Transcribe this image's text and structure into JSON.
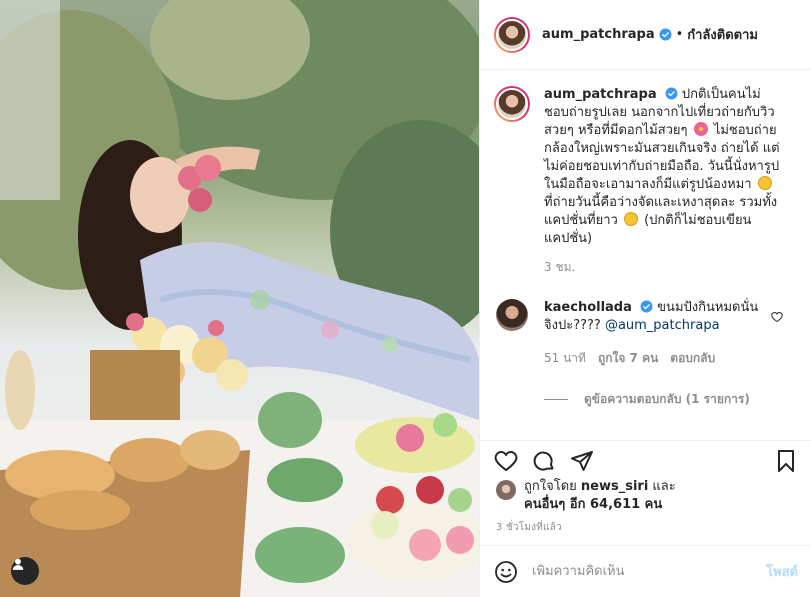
{
  "post": {
    "username": "aum_patchrapa",
    "dot": "•",
    "follow_status": "กำลังติดตาม"
  },
  "caption": {
    "username": "aum_patchrapa",
    "text_part1": " ปกติเป็นคนไม่ชอบถ่ายรูปเลย นอกจากไปเที่ยวถ่ายกับวิวสวยๆ หรือที่มีดอกไม้สวยๆ",
    "text_part2": " ไม่ชอบถ่ายกล้องใหญ่เพราะมันสวยเกินจริง ถ่ายได้ แต่ไม่ค่อยชอบเท่ากับถ่ายมือถือ. วันนี้นั่งหารูปในมือถือจะเอามาลงก็มีแต่รูปน้องหมา",
    "text_part3": " ที่ถ่ายวันนี้คือว่างจัดและเหงาสุดละ รวมทั้งแคปชั่นที่ยาว",
    "text_part4": " (ปกติก็ไม่ชอบเขียนแคปชั่น)",
    "time": "3 ชม."
  },
  "comment": {
    "username": "kaechollada",
    "text": " ขนมปังกินหมดนั่นจิงปะ???? ",
    "mention": "@aum_patchrapa",
    "time": "51 นาที",
    "likes": "ถูกใจ 7 คน",
    "reply": "ตอบกลับ",
    "view_replies": "ดูข้อความตอบกลับ (1 รายการ)"
  },
  "likes": {
    "prefix": "ถูกใจโดย ",
    "user": "news_siri",
    "middle": " และ",
    "others": "คนอื่นๆ อีก 64,611 คน"
  },
  "time_ago": "3 ชั่วโมงที่แล้ว",
  "add_comment": {
    "placeholder": "เพิ่มความคิดเห็น",
    "post_label": "โพสต์"
  },
  "icons": {
    "verified": "verified-badge-icon",
    "heart": "heart-icon",
    "comment": "comment-icon",
    "share": "share-icon",
    "save": "bookmark-icon",
    "emoji": "emoji-icon",
    "user_tag": "user-tag-icon"
  },
  "colors": {
    "verified_blue": "#3897f0",
    "link_blue": "#00376b",
    "post_disabled": "#b3dbff",
    "muted": "#8e8e8e"
  }
}
